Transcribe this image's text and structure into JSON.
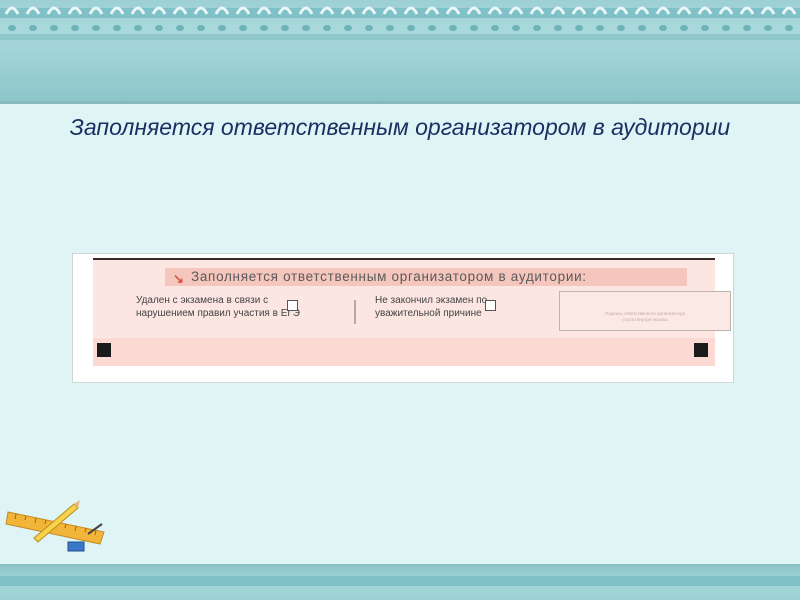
{
  "slide": {
    "title": "Заполняется ответственным организатором в аудитории"
  },
  "form": {
    "header": "Заполняется ответственным организатором в аудитории:",
    "header_icon": "arrow-down-right-icon",
    "field1": {
      "line1": "Удален с экзамена в связи с",
      "line2": "нарушением правил участия в ЕГЭ",
      "checked": false
    },
    "field2": {
      "line1": "Не закончил экзамен по",
      "line2": "уважительной причине",
      "checked": false
    },
    "signature": {
      "line1": "Подпись ответственного организатора",
      "line2": "строго внутри окошка"
    },
    "colors": {
      "header_band": "#f5c6bd",
      "form_background": "#fbe6e2",
      "arrow": "#d9533a"
    }
  },
  "theme": {
    "background": "#dff4f5",
    "band": "#9cd0d4",
    "title_color": "#1c2f63"
  },
  "decor": {
    "icon": "ruler-pencil-icon"
  }
}
